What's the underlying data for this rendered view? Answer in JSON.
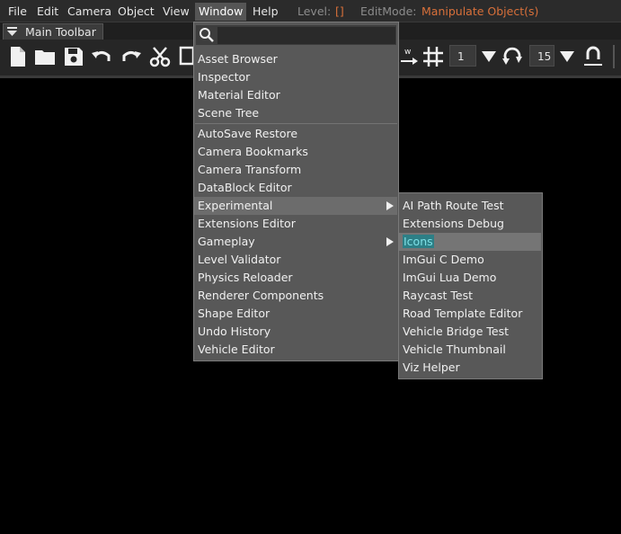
{
  "menubar": {
    "items": [
      "File",
      "Edit",
      "Camera",
      "Object",
      "View",
      "Window",
      "Help"
    ],
    "level_label": "Level:",
    "level_value": "[]",
    "editmode_label": "EditMode:",
    "editmode_value": "Manipulate Object(s)"
  },
  "toolbar": {
    "tab_label": "Main Toolbar",
    "grid_value": "1",
    "rotate_value": "15"
  },
  "window_menu": {
    "search_placeholder": "",
    "group1": [
      "Asset Browser",
      "Inspector",
      "Material Editor",
      "Scene Tree"
    ],
    "group2": [
      "AutoSave Restore",
      "Camera Bookmarks",
      "Camera Transform",
      "DataBlock Editor",
      "Experimental",
      "Extensions Editor",
      "Gameplay",
      "Level Validator",
      "Physics Reloader",
      "Renderer Components",
      "Shape Editor",
      "Undo History",
      "Vehicle Editor"
    ]
  },
  "experimental_submenu": {
    "items": [
      "AI Path Route Test",
      "Extensions Debug",
      "Icons",
      "ImGui C Demo",
      "ImGui Lua Demo",
      "Raycast Test",
      "Road Template Editor",
      "Vehicle Bridge Test",
      "Vehicle Thumbnail",
      "Viz Helper"
    ],
    "highlighted": "Icons"
  },
  "colors": {
    "accent_orange": "#d8703a",
    "highlight_teal": "#2d7f86",
    "menu_bg": "#585858"
  }
}
